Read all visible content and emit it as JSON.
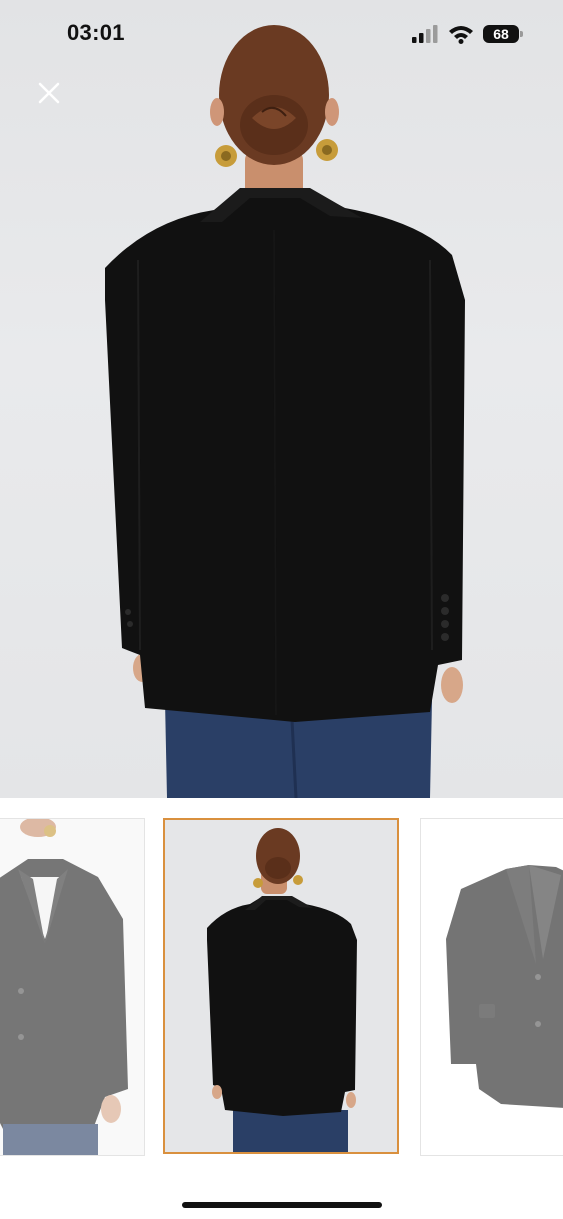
{
  "status_bar": {
    "time": "03:01",
    "battery_level": "68",
    "signal_icon": "cellular-signal-icon",
    "wifi_icon": "wifi-icon",
    "battery_icon": "battery-icon"
  },
  "viewer": {
    "close_icon": "close-icon",
    "main_image": "product-photo-back-view",
    "thumbnails": [
      {
        "name": "thumbnail-front-view",
        "selected": false
      },
      {
        "name": "thumbnail-back-view",
        "selected": true
      },
      {
        "name": "thumbnail-flat-lay",
        "selected": false
      }
    ],
    "selected_thumbnail_index": 1,
    "selected_border_color": "#d9903e"
  },
  "colors": {
    "jacket": "#111111",
    "jeans": "#2a3f66",
    "backdrop": "#e6e7e9"
  }
}
